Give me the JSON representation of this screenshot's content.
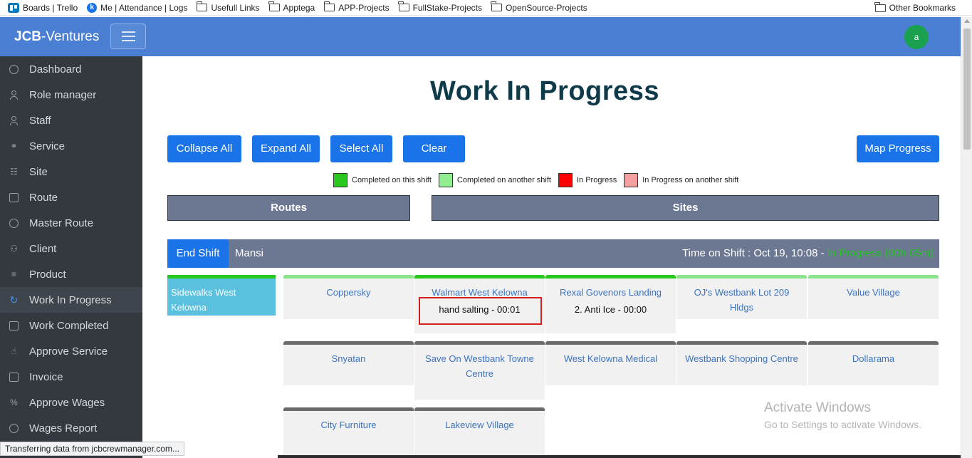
{
  "bookmarks": {
    "items": [
      {
        "label": "Boards | Trello",
        "icon": "trello-icon"
      },
      {
        "label": "Me | Attendance | Logs",
        "icon": "k-icon"
      },
      {
        "label": "Usefull Links",
        "icon": "folder-icon"
      },
      {
        "label": "Apptega",
        "icon": "folder-icon"
      },
      {
        "label": "APP-Projects",
        "icon": "folder-icon"
      },
      {
        "label": "FullStake-Projects",
        "icon": "folder-icon"
      },
      {
        "label": "OpenSource-Projects",
        "icon": "folder-icon"
      }
    ],
    "other": "Other Bookmarks"
  },
  "header": {
    "brand_bold": "JCB",
    "brand_rest": "-Ventures",
    "avatar_initial": "a",
    "color": "#4a7fd4"
  },
  "sidebar": {
    "items": [
      {
        "label": "Dashboard",
        "icon": "dashboard-icon"
      },
      {
        "label": "Role manager",
        "icon": "user-icon"
      },
      {
        "label": "Staff",
        "icon": "user-icon"
      },
      {
        "label": "Service",
        "icon": "link-icon"
      },
      {
        "label": "Site",
        "icon": "sitemap-icon"
      },
      {
        "label": "Route",
        "icon": "route-icon"
      },
      {
        "label": "Master Route",
        "icon": "target-icon"
      },
      {
        "label": "Client",
        "icon": "users-icon"
      },
      {
        "label": "Product",
        "icon": "handshake-icon"
      },
      {
        "label": "Work In Progress",
        "icon": "sync-icon"
      },
      {
        "label": "Work Completed",
        "icon": "inbox-icon"
      },
      {
        "label": "Approve Service",
        "icon": "thumbs-up-icon"
      },
      {
        "label": "Invoice",
        "icon": "copy-icon"
      },
      {
        "label": "Approve Wages",
        "icon": "percent-icon"
      },
      {
        "label": "Wages Report",
        "icon": "ban-icon"
      }
    ],
    "active_index": 9
  },
  "main": {
    "title": "Work In Progress",
    "buttons": {
      "collapse_all": "Collapse All",
      "expand_all": "Expand All",
      "select_all": "Select All",
      "clear": "Clear",
      "map_progress": "Map Progress"
    },
    "legend": [
      {
        "label": "Completed on this shift",
        "color": "#28c81e"
      },
      {
        "label": "Completed on another shift",
        "color": "#90ee90"
      },
      {
        "label": "In Progress",
        "color": "#ff0000"
      },
      {
        "label": "In Progress on another shift",
        "color": "#f4a0a0"
      }
    ],
    "tabs": {
      "routes": "Routes",
      "sites": "Sites"
    },
    "shift": {
      "end_shift": "End Shift",
      "name": "Mansi",
      "time_label": "Time on Shift : Oct 19, 10:08 -",
      "status": "In Progress (00h 05m)"
    },
    "route": {
      "name": "Sidewalks West Kelowna"
    },
    "sites": [
      {
        "name": "Coppersky",
        "task": "",
        "status": "completed-other"
      },
      {
        "name": "Walmart West Kelowna",
        "task": "hand salting - 00:01",
        "status": "completed-this"
      },
      {
        "name": "Rexal Govenors Landing",
        "task": "2. Anti Ice - 00:00",
        "status": "completed-this"
      },
      {
        "name": "OJ's Westbank Lot 209 Hldgs",
        "task": "",
        "status": "completed-other"
      },
      {
        "name": "Value Village",
        "task": "",
        "status": "completed-other"
      },
      {
        "name": "Snyatan",
        "task": "",
        "status": "pending"
      },
      {
        "name": "Save On Westbank Towne Centre",
        "task": "",
        "status": "pending"
      },
      {
        "name": "West Kelowna Medical",
        "task": "",
        "status": "pending"
      },
      {
        "name": "Westbank Shopping Centre",
        "task": "",
        "status": "pending"
      },
      {
        "name": "Dollarama",
        "task": "",
        "status": "pending"
      },
      {
        "name": "City Furniture",
        "task": "",
        "status": "pending"
      },
      {
        "name": "Lakeview Village",
        "task": "",
        "status": "pending"
      }
    ]
  },
  "watermark": {
    "line1": "Activate Windows",
    "line2": "Go to Settings to activate Windows."
  },
  "status_bar": "Transferring data from jcbcrewmanager.com..."
}
